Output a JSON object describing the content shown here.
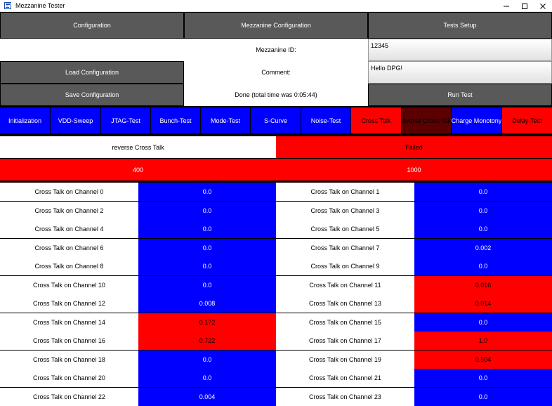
{
  "window": {
    "title": "Mezzanine Tester",
    "icon": "app-window-icon"
  },
  "header": {
    "configuration_label": "Configuration",
    "mezzanine_configuration_label": "Mezzanine Configuration",
    "tests_setup_label": "Tests Setup"
  },
  "form": {
    "mezzanine_id_label": "Mezzanine ID:",
    "mezzanine_id_value": "12345",
    "comment_label": "Comment:",
    "comment_value": "Hello DPG!",
    "load_label": "Load Configuration",
    "save_label": "Save Configuration",
    "status_text": "Done (total time was 0:05:44)",
    "run_label": "Run Test"
  },
  "tabs": [
    {
      "label": "Initialization",
      "status": "pass"
    },
    {
      "label": "VDD-Sweep",
      "status": "pass"
    },
    {
      "label": "JTAG-Test",
      "status": "pass"
    },
    {
      "label": "Bunch-Test",
      "status": "pass"
    },
    {
      "label": "Mode-Test",
      "status": "pass"
    },
    {
      "label": "S-Curve",
      "status": "pass"
    },
    {
      "label": "Noise-Test",
      "status": "pass"
    },
    {
      "label": "Cross Talk",
      "status": "fail"
    },
    {
      "label": "reverse Cross Talk",
      "status": "active"
    },
    {
      "label": "Charge Monotony",
      "status": "pass"
    },
    {
      "label": "Delay-Test",
      "status": "fail"
    }
  ],
  "test_summary": {
    "name": "reverse Cross Talk",
    "result": "Failed",
    "param_a": "400",
    "param_b": "1000"
  },
  "colors": {
    "pass": "#0000ff",
    "fail": "#ff0000",
    "active": "#5a0000",
    "button": "#595959"
  },
  "channels": [
    {
      "label": "Cross Talk on Channel 0",
      "value": "0.0",
      "status": "pass"
    },
    {
      "label": "Cross Talk on Channel 1",
      "value": "0.0",
      "status": "pass"
    },
    {
      "label": "Cross Talk on Channel 2",
      "value": "0.0",
      "status": "pass"
    },
    {
      "label": "Cross Talk on Channel 3",
      "value": "0.0",
      "status": "pass"
    },
    {
      "label": "Cross Talk on Channel 4",
      "value": "0.0",
      "status": "pass"
    },
    {
      "label": "Cross Talk on Channel 5",
      "value": "0.0",
      "status": "pass"
    },
    {
      "label": "Cross Talk on Channel 6",
      "value": "0.0",
      "status": "pass"
    },
    {
      "label": "Cross Talk on Channel 7",
      "value": "0.002",
      "status": "pass"
    },
    {
      "label": "Cross Talk on Channel 8",
      "value": "0.0",
      "status": "pass"
    },
    {
      "label": "Cross Talk on Channel 9",
      "value": "0.0",
      "status": "pass"
    },
    {
      "label": "Cross Talk on Channel 10",
      "value": "0.0",
      "status": "pass"
    },
    {
      "label": "Cross Talk on Channel 11",
      "value": "0.016",
      "status": "fail"
    },
    {
      "label": "Cross Talk on Channel 12",
      "value": "0.008",
      "status": "pass"
    },
    {
      "label": "Cross Talk on Channel 13",
      "value": "0.014",
      "status": "fail"
    },
    {
      "label": "Cross Talk on Channel 14",
      "value": "0.172",
      "status": "fail"
    },
    {
      "label": "Cross Talk on Channel 15",
      "value": "0.0",
      "status": "pass"
    },
    {
      "label": "Cross Talk on Channel 16",
      "value": "0.722",
      "status": "fail"
    },
    {
      "label": "Cross Talk on Channel 17",
      "value": "1.0",
      "status": "fail"
    },
    {
      "label": "Cross Talk on Channel 18",
      "value": "0.0",
      "status": "pass"
    },
    {
      "label": "Cross Talk on Channel 19",
      "value": "0.504",
      "status": "fail"
    },
    {
      "label": "Cross Talk on Channel 20",
      "value": "0.0",
      "status": "pass"
    },
    {
      "label": "Cross Talk on Channel 21",
      "value": "0.0",
      "status": "pass"
    },
    {
      "label": "Cross Talk on Channel 22",
      "value": "0.004",
      "status": "pass"
    },
    {
      "label": "Cross Talk on Channel 23",
      "value": "0.0",
      "status": "pass"
    }
  ]
}
